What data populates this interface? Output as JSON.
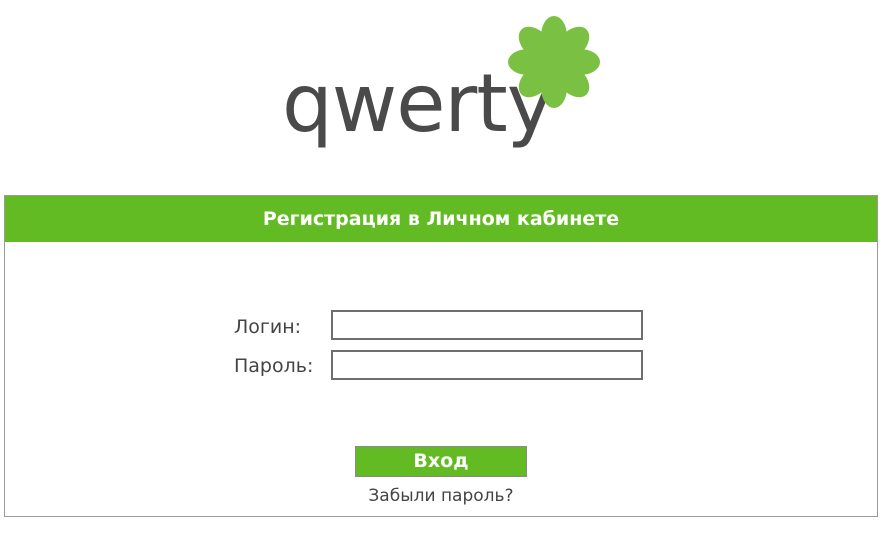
{
  "logo": {
    "text": "qwerty",
    "icon": "green-flower-icon",
    "text_color": "#4a4a4a",
    "flower_color": "#7ac143"
  },
  "panel": {
    "title": "Регистрация в Личном кабинете",
    "accent_color": "#63bb23"
  },
  "form": {
    "login_label": "Логин:",
    "login_value": "",
    "password_label": "Пароль:",
    "password_value": "",
    "submit_label": "Вход",
    "forgot_label": "Забыли пароль?"
  }
}
